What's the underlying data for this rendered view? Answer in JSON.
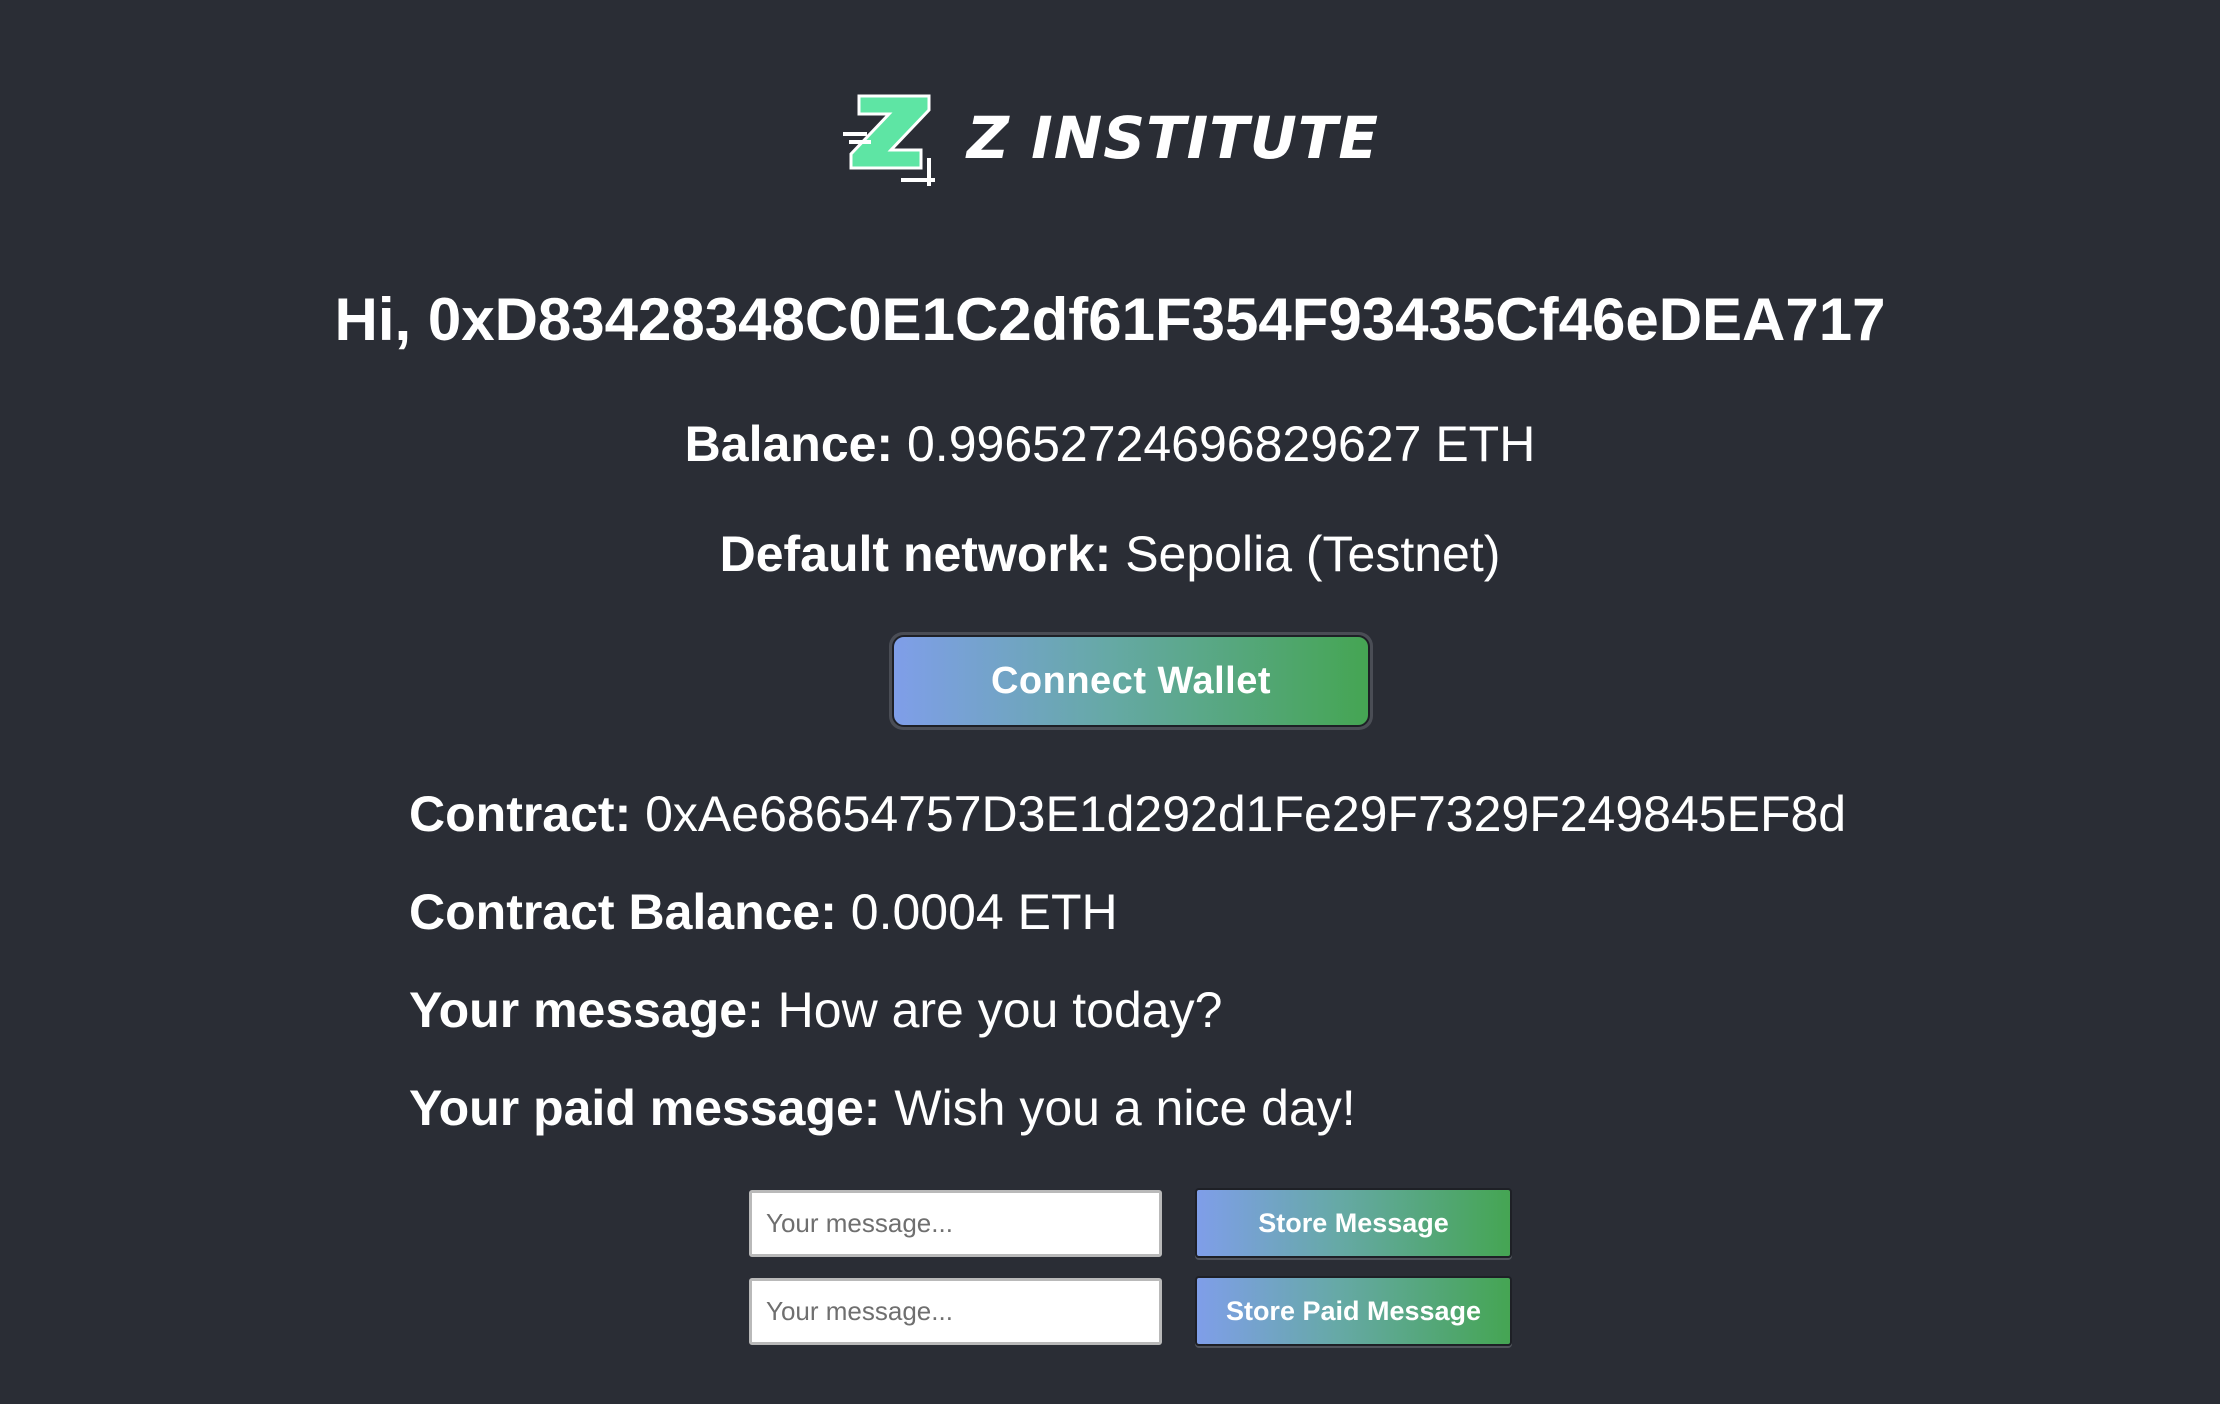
{
  "brand": {
    "name": "Z INSTITUTE",
    "accent": "#5ee5a4"
  },
  "greeting": "Hi, 0xD83428348C0E1C2df61F354F93435Cf46eDEA717",
  "account": {
    "balance_label": "Balance:",
    "balance_value": "0.99652724696829627 ETH",
    "network_label": "Default network:",
    "network_value": "Sepolia (Testnet)"
  },
  "connect_button": "Connect Wallet",
  "contract": {
    "address_label": "Contract:",
    "address_value": "0xAe68654757D3E1d292d1Fe29F7329F249845EF8d",
    "balance_label": "Contract Balance:",
    "balance_value": "0.0004 ETH",
    "message_label": "Your message:",
    "message_value": "How are you today?",
    "paid_message_label": "Your paid message:",
    "paid_message_value": "Wish you a nice day!"
  },
  "forms": {
    "message_input": {
      "value": "",
      "placeholder": "Your message..."
    },
    "paid_message_input": {
      "value": "",
      "placeholder": "Your message..."
    },
    "store_button": "Store Message",
    "store_paid_button": "Store Paid Message"
  },
  "colors": {
    "background": "#2a2d35",
    "button_gradient_start": "#7f9ee9",
    "button_gradient_end": "#45a553"
  }
}
